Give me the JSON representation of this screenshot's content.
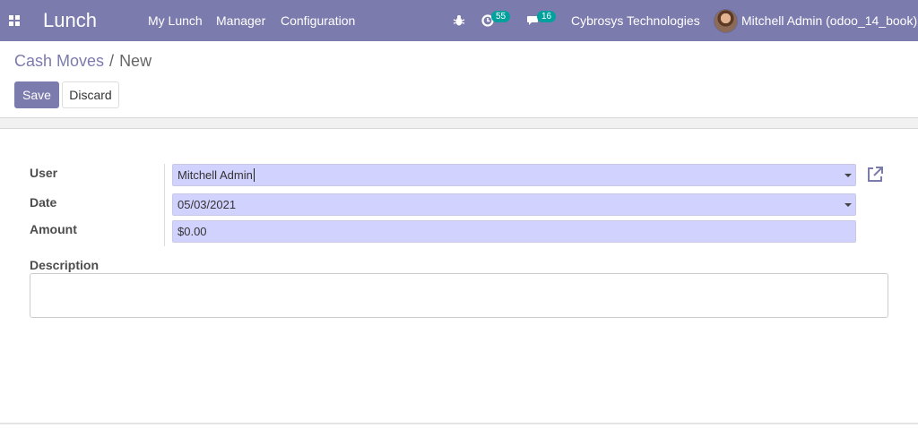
{
  "navbar": {
    "app_name": "Lunch",
    "menu": [
      "My Lunch",
      "Manager",
      "Configuration"
    ],
    "activity_count": "55",
    "message_count": "16",
    "company": "Cybrosys Technologies",
    "user": "Mitchell Admin (odoo_14_book)",
    "color": "#7c7bad",
    "badge_color": "#00a09d"
  },
  "breadcrumb": {
    "parent": "Cash Moves",
    "separator": "/",
    "current": "New"
  },
  "buttons": {
    "save": "Save",
    "discard": "Discard"
  },
  "form": {
    "user_label": "User",
    "user_value": "Mitchell Admin",
    "date_label": "Date",
    "date_value": "05/03/2021",
    "amount_label": "Amount",
    "amount_value": "$0.00",
    "description_label": "Description",
    "description_value": ""
  },
  "icons": {
    "apps": "apps-grid-icon",
    "debug": "bug-icon",
    "activity": "clock-icon",
    "messages": "chat-icon",
    "external": "external-link-icon"
  }
}
